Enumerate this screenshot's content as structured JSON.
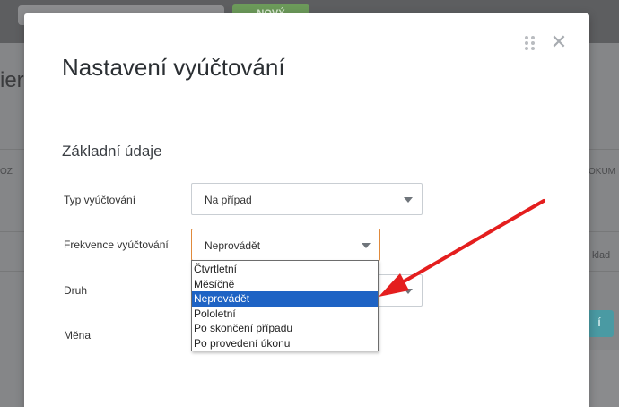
{
  "background": {
    "new_button": "NOVÝ",
    "title_fragment": "ier",
    "left_text": "OZ",
    "right_text": "OKUM",
    "right_text2": "klad",
    "teal_button": "Í"
  },
  "modal": {
    "title": "Nastavení vyúčtování",
    "section_title": "Základní údaje",
    "fields": {
      "typ": {
        "label": "Typ vyúčtování",
        "value": "Na případ"
      },
      "frekvence": {
        "label": "Frekvence vyúčtování",
        "value": "Neprovádět"
      },
      "druh": {
        "label": "Druh",
        "value": ""
      },
      "mena": {
        "label": "Měna",
        "value": ""
      }
    },
    "dropdown_options": [
      "Čtvrtletní",
      "Měsíčně",
      "Neprovádět",
      "Pololetní",
      "Po skončení případu",
      "Po provedení úkonu"
    ],
    "selected_option": "Neprovádět"
  },
  "annotation": {
    "color": "#e41e1e"
  },
  "icons": {
    "drag": "drag-handle-icon",
    "close": "close-icon"
  }
}
